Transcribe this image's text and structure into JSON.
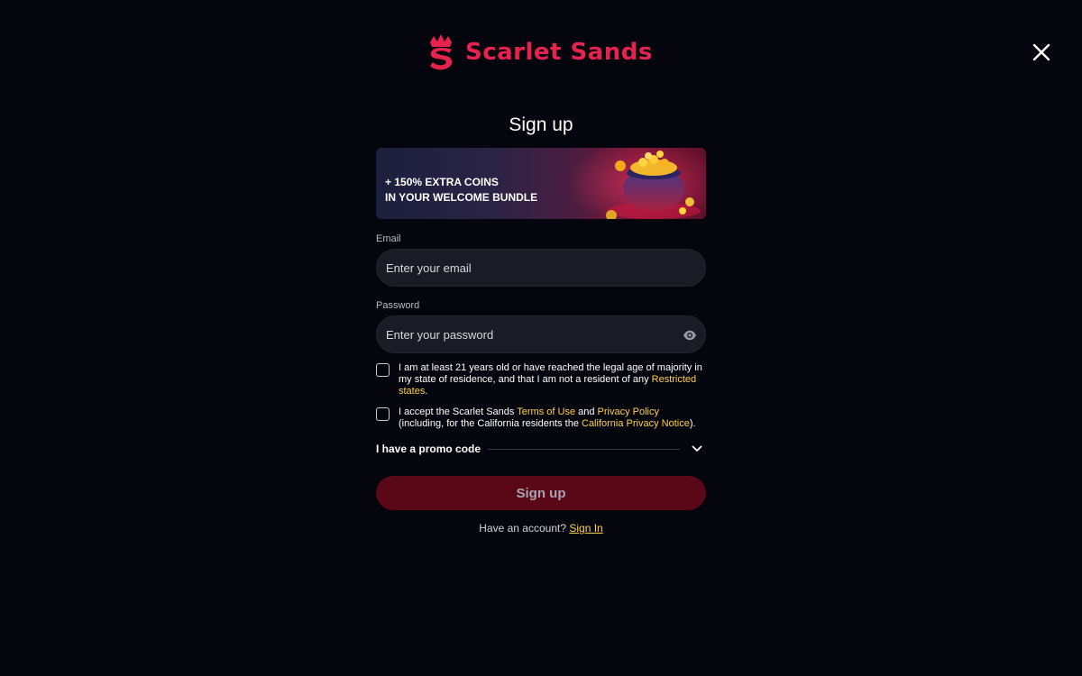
{
  "brand": {
    "name": "Scarlet Sands",
    "accent_color": "#e8224e",
    "link_color": "#ffd23f"
  },
  "icons": {
    "logo": "crown-s-logo-icon",
    "close": "close-icon",
    "eye": "eye-icon",
    "chevron": "chevron-down-icon",
    "banner_art": "pot-of-gold-coins-icon"
  },
  "modal": {
    "title": "Sign up",
    "banner": {
      "line1": "+ 150% EXTRA COINS",
      "line2": "IN YOUR WELCOME BUNDLE"
    },
    "email": {
      "label": "Email",
      "placeholder": "Enter your email"
    },
    "password": {
      "label": "Password",
      "placeholder": "Enter your password"
    },
    "age_consent": {
      "text": "I am at least 21 years old or have reached the legal age of majority in my state of residence, and that I am not a resident of any ",
      "link": "Restricted states",
      "suffix": ".",
      "checked": false
    },
    "terms_consent": {
      "text1": "I accept the Scarlet Sands ",
      "link1": "Terms of Use",
      "text2": " and ",
      "link2": "Privacy Policy",
      "text3": " (including, for the California residents the ",
      "link3": "California Privacy Notice",
      "text4": ").",
      "checked": false
    },
    "promo_label": "I have a promo code",
    "submit_label": "Sign up",
    "footer": {
      "question": "Have an account? ",
      "link": "Sign In"
    }
  }
}
